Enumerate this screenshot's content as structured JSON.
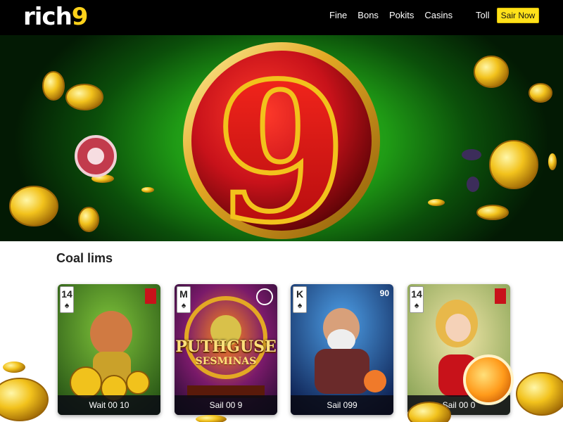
{
  "header": {
    "logo_white": "rich",
    "logo_yellow": "9",
    "nav": [
      "Fine",
      "Bons",
      "Pokits",
      "Casins"
    ],
    "extra": "Toll",
    "cta": "Sair Now"
  },
  "section": {
    "title": "Coal lims"
  },
  "cards": [
    {
      "rank": "14",
      "suit": "♠",
      "title": "",
      "caption": "Wait 00 10"
    },
    {
      "rank": "M",
      "suit": "♠",
      "title_line1": "PUTHGUSE",
      "title_line2": "SESMINAS",
      "caption": "Sail 00 9"
    },
    {
      "rank": "K",
      "suit": "♠",
      "badge": "90",
      "caption": "Sail 099"
    },
    {
      "rank": "14",
      "suit": "♠",
      "caption": "Sail 00 0"
    }
  ],
  "colors": {
    "accent": "#ffd21a",
    "header_bg": "#000000",
    "hero_green": "#1f9a15",
    "hero_red": "#c8121a"
  }
}
